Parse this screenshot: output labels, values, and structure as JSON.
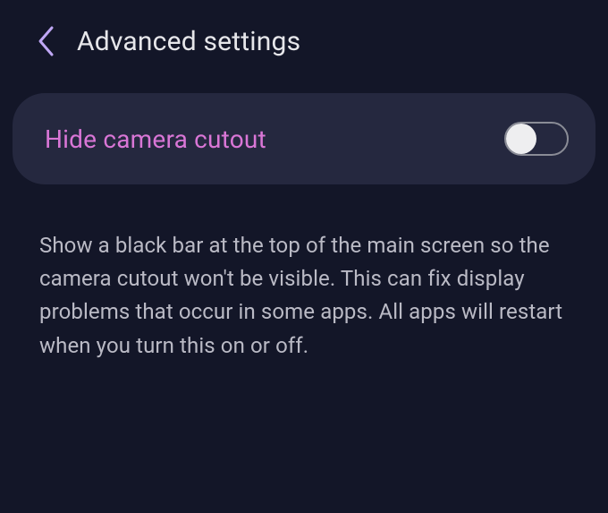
{
  "header": {
    "title": "Advanced settings"
  },
  "setting": {
    "label": "Hide camera cutout",
    "enabled": false
  },
  "description": "Show a black bar at the top of the main screen so the camera cutout won't be visible. This can fix display problems that occur in some apps. All apps will restart when you turn this on or off.",
  "colors": {
    "background": "#131628",
    "card": "#25283f",
    "accent": "#d976d6",
    "text": "#e6e6ea",
    "textSecondary": "#babac5",
    "backChevron": "#bfa7f5"
  }
}
